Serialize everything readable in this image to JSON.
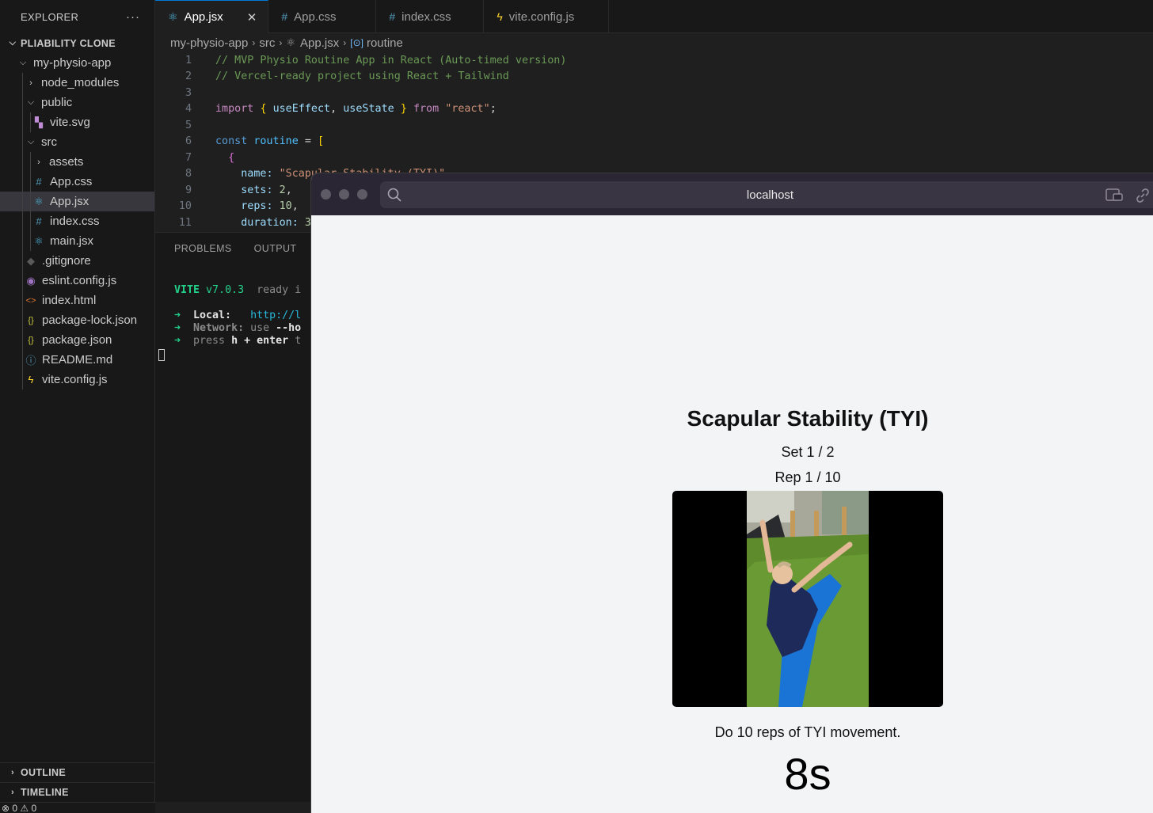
{
  "sidebar": {
    "header": "EXPLORER",
    "more": "···",
    "project": "PLIABILITY CLONE",
    "tree": [
      {
        "label": "my-physio-app",
        "kind": "folder-open",
        "depth": 0
      },
      {
        "label": "node_modules",
        "kind": "folder-closed",
        "depth": 1
      },
      {
        "label": "public",
        "kind": "folder-open",
        "depth": 1
      },
      {
        "label": "vite.svg",
        "kind": "svg-file",
        "depth": 2
      },
      {
        "label": "src",
        "kind": "folder-open",
        "depth": 1
      },
      {
        "label": "assets",
        "kind": "folder-closed",
        "depth": 2
      },
      {
        "label": "App.css",
        "kind": "css-file",
        "depth": 2
      },
      {
        "label": "App.jsx",
        "kind": "react-file",
        "depth": 2,
        "selected": true
      },
      {
        "label": "index.css",
        "kind": "css-file",
        "depth": 2
      },
      {
        "label": "main.jsx",
        "kind": "react-file",
        "depth": 2
      },
      {
        "label": ".gitignore",
        "kind": "git-file",
        "depth": 1
      },
      {
        "label": "eslint.config.js",
        "kind": "eslint-file",
        "depth": 1
      },
      {
        "label": "index.html",
        "kind": "html-file",
        "depth": 1
      },
      {
        "label": "package-lock.json",
        "kind": "json-file",
        "depth": 1
      },
      {
        "label": "package.json",
        "kind": "json-file",
        "depth": 1
      },
      {
        "label": "README.md",
        "kind": "info-file",
        "depth": 1
      },
      {
        "label": "vite.config.js",
        "kind": "vite-file",
        "depth": 1
      }
    ],
    "outline": "OUTLINE",
    "timeline": "TIMELINE",
    "status": "⊗ 0 ⚠ 0"
  },
  "tabs": [
    {
      "label": "App.jsx",
      "icon": "react-icon",
      "active": true
    },
    {
      "label": "App.css",
      "icon": "hash-icon"
    },
    {
      "label": "index.css",
      "icon": "hash-icon"
    },
    {
      "label": "vite.config.js",
      "icon": "vite-icon"
    }
  ],
  "breadcrumb": [
    "my-physio-app",
    "src",
    "App.jsx",
    "routine"
  ],
  "code": {
    "line_numbers": [
      "1",
      "2",
      "3",
      "4",
      "5",
      "6",
      "7",
      "8",
      "9",
      "10",
      "11"
    ],
    "l1": "// MVP Physio Routine App in React (Auto-timed version)",
    "l2": "// Vercel-ready project using React + Tailwind",
    "l4": {
      "kw": "import",
      "open": "{",
      "a": "useEffect",
      "comma": ",",
      "b": "useState",
      "close": "}",
      "from": "from",
      "str": "\"react\"",
      "semi": ";"
    },
    "l6": {
      "kw": "const",
      "name": "routine",
      "eq": "=",
      "br": "["
    },
    "l7": "{",
    "l8": {
      "prop": "name:",
      "str": "\"Scapular Stability (TYI)\","
    },
    "l9": {
      "prop": "sets:",
      "num": "2",
      "comma": ","
    },
    "l10": {
      "prop": "reps:",
      "num": "10",
      "comma": ","
    },
    "l11": {
      "prop": "duration:",
      "rest": "3"
    }
  },
  "panel": {
    "tabs": [
      "PROBLEMS",
      "OUTPUT"
    ],
    "vite": "VITE",
    "version": "v7.0.3",
    "ready": "ready i",
    "local_label": "Local:",
    "local_url": "http://l",
    "network_label": "Network:",
    "network_text": "use ",
    "network_flag": "--ho",
    "press": "press",
    "h": "h",
    "plus": "+",
    "enter": "enter",
    "tail": "t"
  },
  "browser": {
    "url": "localhost",
    "title": "Scapular Stability (TYI)",
    "set_info": "Set 1 / 2",
    "rep_info": "Rep 1 / 10",
    "description": "Do 10 reps of TYI movement.",
    "timer": "8s"
  }
}
